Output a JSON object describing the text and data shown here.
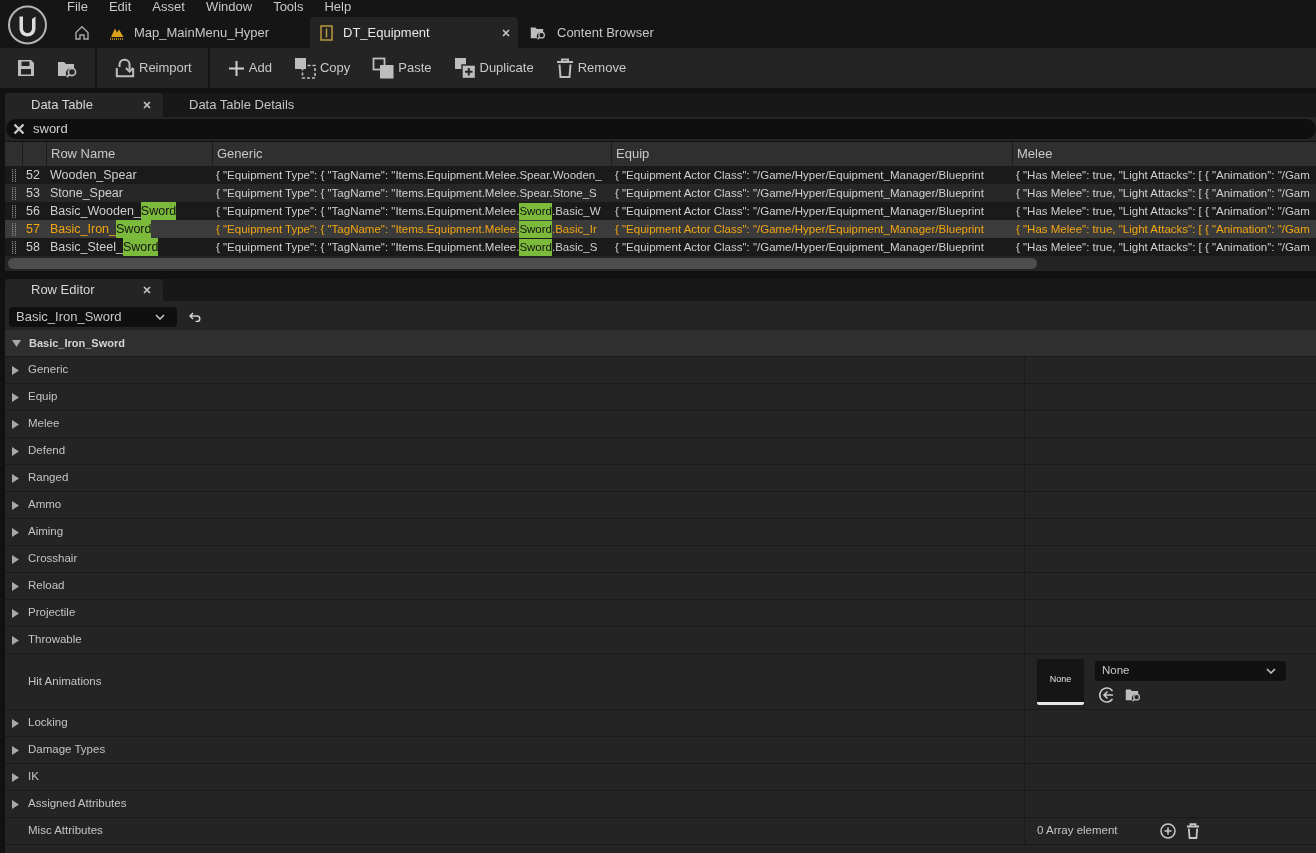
{
  "menu": [
    {
      "label": "File"
    },
    {
      "label": "Edit"
    },
    {
      "label": "Asset"
    },
    {
      "label": "Window"
    },
    {
      "label": "Tools"
    },
    {
      "label": "Help"
    }
  ],
  "document_tabs": [
    {
      "kind": "home",
      "selected": false,
      "closable": false
    },
    {
      "kind": "map",
      "label": "Map_MainMenu_Hyper",
      "selected": false,
      "closable": false
    },
    {
      "kind": "data_table",
      "label": "DT_Equipment",
      "selected": true,
      "closable": true
    },
    {
      "kind": "browser",
      "label": "Content Browser",
      "selected": false,
      "closable": false
    }
  ],
  "toolbar": [
    {
      "buttons": [
        {
          "kind": "save"
        },
        {
          "kind": "browse"
        }
      ]
    },
    {
      "buttons": [
        {
          "kind": "reimport",
          "label": "Reimport"
        }
      ]
    },
    {
      "buttons": [
        {
          "kind": "add",
          "label": "Add"
        },
        {
          "kind": "copy",
          "label": "Copy"
        },
        {
          "kind": "paste",
          "label": "Paste"
        },
        {
          "kind": "duplicate",
          "label": "Duplicate"
        },
        {
          "kind": "remove",
          "label": "Remove"
        }
      ]
    }
  ],
  "data_table_panel": {
    "tabs": [
      {
        "label": "Data Table",
        "selected": true,
        "closable": true
      },
      {
        "label": "Data Table Details",
        "selected": false,
        "closable": false
      }
    ],
    "search": {
      "value": "sword"
    },
    "table": {
      "columns": [
        "Row Name",
        "Generic",
        "Equip",
        "Melee"
      ],
      "rows": [
        {
          "number": "52",
          "selected": false,
          "cells": [
            [
              {
                "text": "Wooden_Spear",
                "match": false
              }
            ],
            [
              {
                "text": "{ \"Equipment Type\": { \"TagName\": \"Items.Equipment.Melee.Spear.Wooden_",
                "match": false
              }
            ],
            [
              {
                "text": "{ \"Equipment Actor Class\": \"/Game/Hyper/Equipment_Manager/Blueprint",
                "match": false
              }
            ],
            [
              {
                "text": "{ \"Has Melee\": true, \"Light Attacks\": [ { \"Animation\": \"/Gam",
                "match": false
              }
            ]
          ]
        },
        {
          "number": "53",
          "selected": false,
          "cells": [
            [
              {
                "text": "Stone_Spear",
                "match": false
              }
            ],
            [
              {
                "text": "{ \"Equipment Type\": { \"TagName\": \"Items.Equipment.Melee.Spear.Stone_S",
                "match": false
              }
            ],
            [
              {
                "text": "{ \"Equipment Actor Class\": \"/Game/Hyper/Equipment_Manager/Blueprint",
                "match": false
              }
            ],
            [
              {
                "text": "{ \"Has Melee\": true, \"Light Attacks\": [ { \"Animation\": \"/Gam",
                "match": false
              }
            ]
          ]
        },
        {
          "number": "56",
          "selected": false,
          "cells": [
            [
              {
                "text": "Basic_Wooden_",
                "match": false
              },
              {
                "text": "Sword",
                "match": true
              }
            ],
            [
              {
                "text": "{ \"Equipment Type\": { \"TagName\": \"Items.Equipment.Melee.",
                "match": false
              },
              {
                "text": "Sword",
                "match": true
              },
              {
                "text": ".Basic_W",
                "match": false
              }
            ],
            [
              {
                "text": "{ \"Equipment Actor Class\": \"/Game/Hyper/Equipment_Manager/Blueprint",
                "match": false
              }
            ],
            [
              {
                "text": "{ \"Has Melee\": true, \"Light Attacks\": [ { \"Animation\": \"/Gam",
                "match": false
              }
            ]
          ]
        },
        {
          "number": "57",
          "selected": true,
          "cells": [
            [
              {
                "text": "Basic_Iron_",
                "match": false
              },
              {
                "text": "Sword",
                "match": true
              }
            ],
            [
              {
                "text": "{ \"Equipment Type\": { \"TagName\": \"Items.Equipment.Melee.",
                "match": false
              },
              {
                "text": "Sword",
                "match": true
              },
              {
                "text": ".Basic_Ir",
                "match": false
              }
            ],
            [
              {
                "text": "{ \"Equipment Actor Class\": \"/Game/Hyper/Equipment_Manager/Blueprint",
                "match": false
              }
            ],
            [
              {
                "text": "{ \"Has Melee\": true, \"Light Attacks\": [ { \"Animation\": \"/Gam",
                "match": false
              }
            ]
          ]
        },
        {
          "number": "58",
          "selected": false,
          "cells": [
            [
              {
                "text": "Basic_Steel_",
                "match": false
              },
              {
                "text": "Sword",
                "match": true
              }
            ],
            [
              {
                "text": "{ \"Equipment Type\": { \"TagName\": \"Items.Equipment.Melee.",
                "match": false
              },
              {
                "text": "Sword",
                "match": true
              },
              {
                "text": ".Basic_S",
                "match": false
              }
            ],
            [
              {
                "text": "{ \"Equipment Actor Class\": \"/Game/Hyper/Equipment_Manager/Blueprint",
                "match": false
              }
            ],
            [
              {
                "text": "{ \"Has Melee\": true, \"Light Attacks\": [ { \"Animation\": \"/Gam",
                "match": false
              }
            ]
          ]
        }
      ]
    }
  },
  "row_editor": {
    "tabs": [
      {
        "label": "Row Editor",
        "selected": true,
        "closable": true
      }
    ],
    "row_picker": {
      "value": "Basic_Iron_Sword"
    },
    "category": {
      "label": "Basic_Iron_Sword",
      "expanded": true
    },
    "properties": [
      {
        "kind": "struct",
        "label": "Generic",
        "expanded": false
      },
      {
        "kind": "struct",
        "label": "Equip",
        "expanded": false
      },
      {
        "kind": "struct",
        "label": "Melee",
        "expanded": false
      },
      {
        "kind": "struct",
        "label": "Defend",
        "expanded": false
      },
      {
        "kind": "struct",
        "label": "Ranged",
        "expanded": false
      },
      {
        "kind": "struct",
        "label": "Ammo",
        "expanded": false
      },
      {
        "kind": "struct",
        "label": "Aiming",
        "expanded": false
      },
      {
        "kind": "struct",
        "label": "Crosshair",
        "expanded": false
      },
      {
        "kind": "struct",
        "label": "Reload",
        "expanded": false
      },
      {
        "kind": "struct",
        "label": "Projectile",
        "expanded": false
      },
      {
        "kind": "struct",
        "label": "Throwable",
        "expanded": false
      },
      {
        "kind": "asset",
        "label": "Hit Animations",
        "thumbnail_label": "None",
        "value": "None"
      },
      {
        "kind": "struct",
        "label": "Locking",
        "expanded": false
      },
      {
        "kind": "struct",
        "label": "Damage Types",
        "expanded": false
      },
      {
        "kind": "struct",
        "label": "IK",
        "expanded": false
      },
      {
        "kind": "struct",
        "label": "Assigned Attributes",
        "expanded": false
      },
      {
        "kind": "array",
        "label": "Misc Attributes",
        "value": "0 Array element"
      }
    ]
  }
}
